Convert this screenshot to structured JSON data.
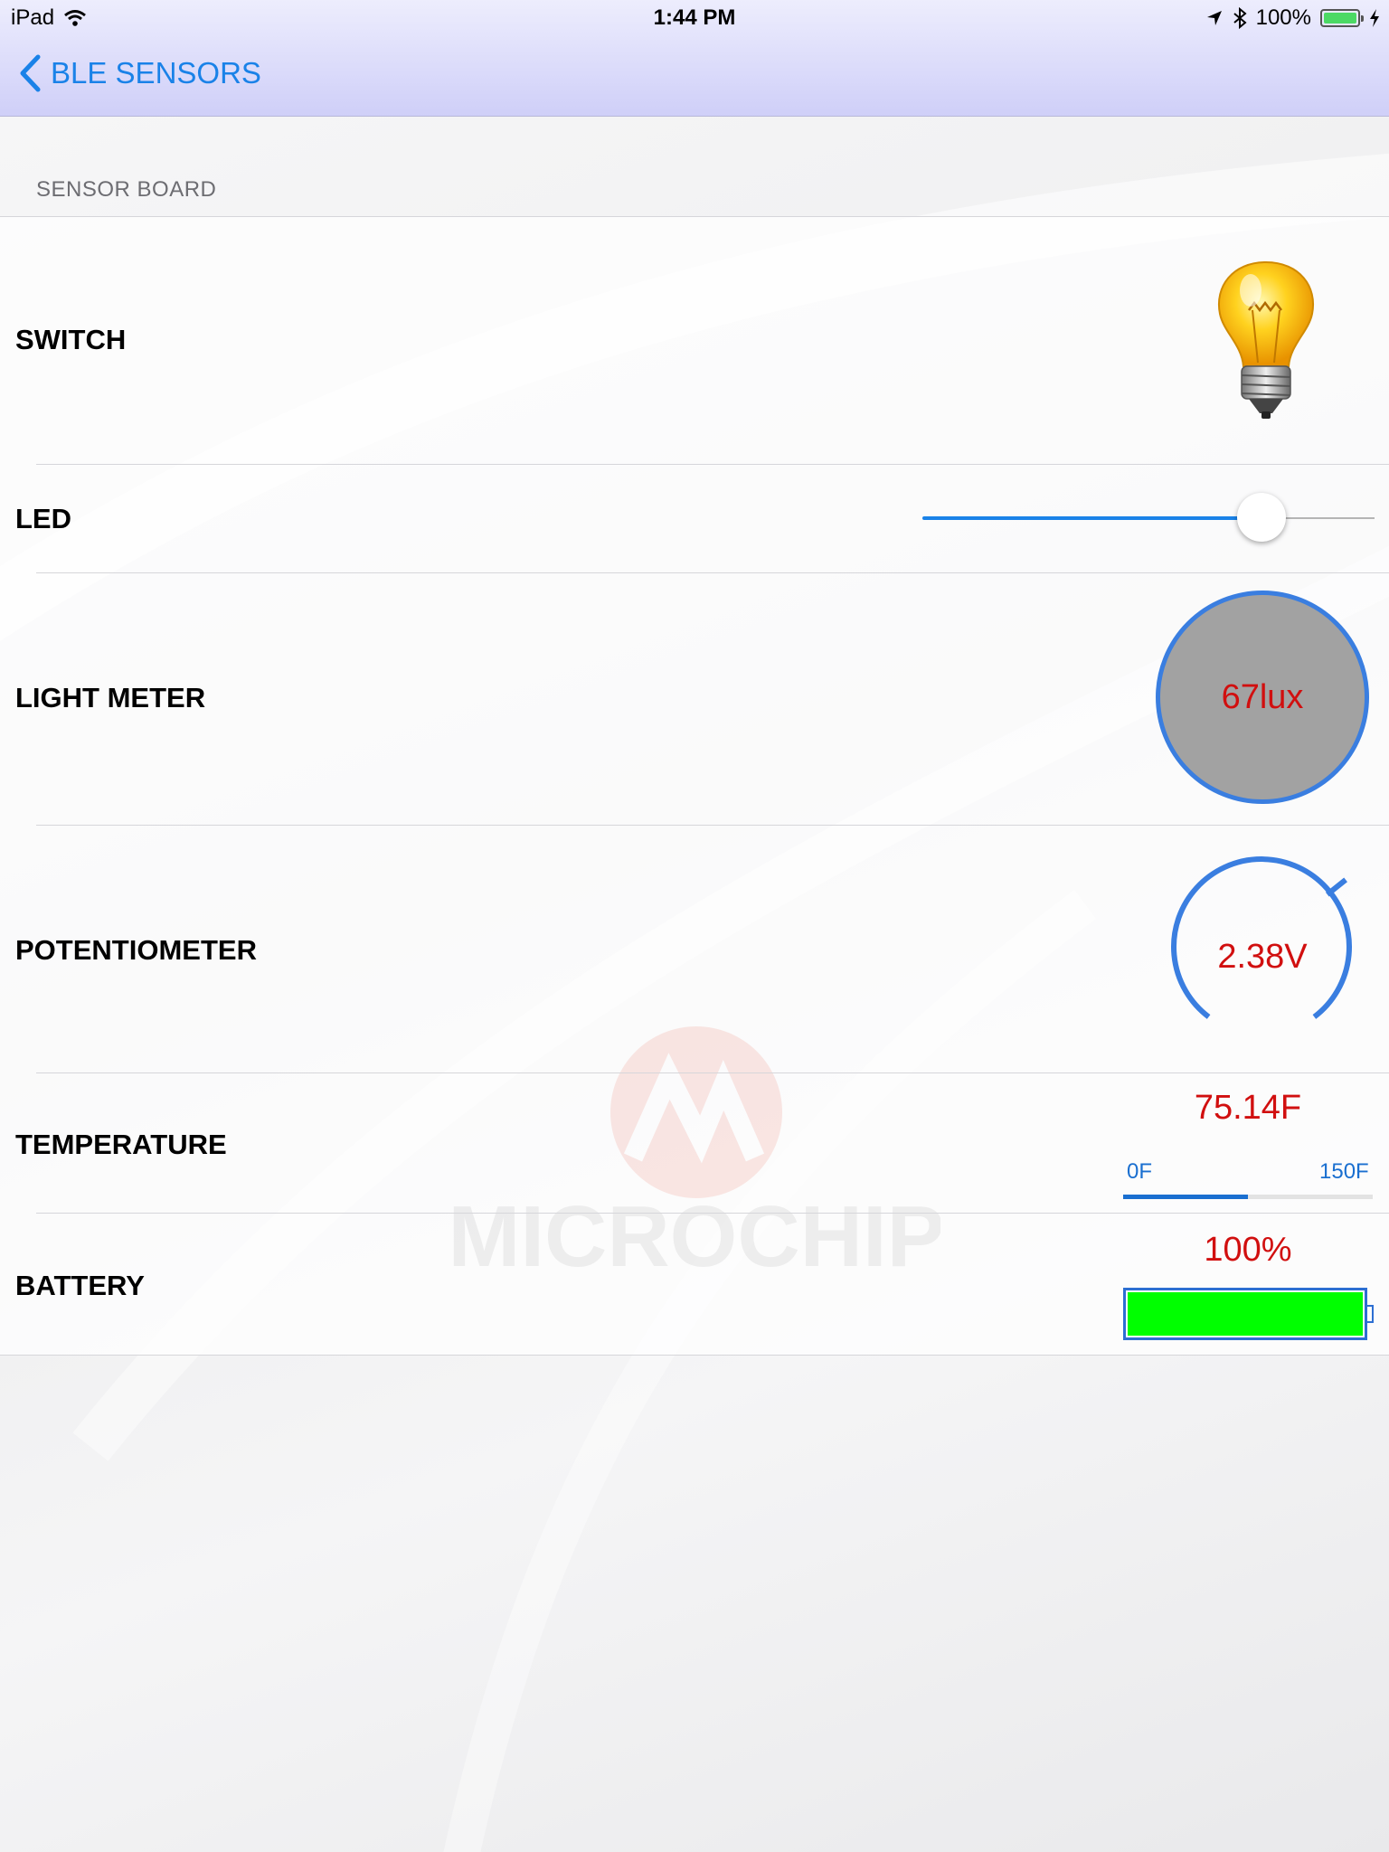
{
  "status_bar": {
    "device": "iPad",
    "time": "1:44 PM",
    "battery_percent": "100%",
    "icons": [
      "wifi-icon",
      "location-arrow-icon",
      "bluetooth-icon",
      "battery-icon",
      "charging-bolt-icon"
    ]
  },
  "nav": {
    "back_label": "BLE SENSORS",
    "back_icon": "chevron-left-icon"
  },
  "section": {
    "header": "SENSOR BOARD",
    "watermark_text": "MICROCHIP"
  },
  "rows": {
    "switch": {
      "label": "SWITCH",
      "icon": "lightbulb-icon",
      "state": "on"
    },
    "led": {
      "label": "LED",
      "slider_value": 0.78
    },
    "light_meter": {
      "label": "LIGHT METER",
      "value": "67lux"
    },
    "potentiometer": {
      "label": "POTENTIOMETER",
      "value": "2.38V",
      "gauge_fraction": 0.68
    },
    "temperature": {
      "label": "TEMPERATURE",
      "value": "75.14F",
      "min_label": "0F",
      "max_label": "150F",
      "fill_fraction": 0.5
    },
    "battery": {
      "label": "BATTERY",
      "value": "100%",
      "fill_fraction": 1.0
    }
  },
  "colors": {
    "accent": "#1a82e8",
    "value_text": "#d10f0f",
    "battery_fill": "#00ff00",
    "gauge_ring": "#3a7ee0",
    "light_meter_fill": "#a2a2a2"
  }
}
